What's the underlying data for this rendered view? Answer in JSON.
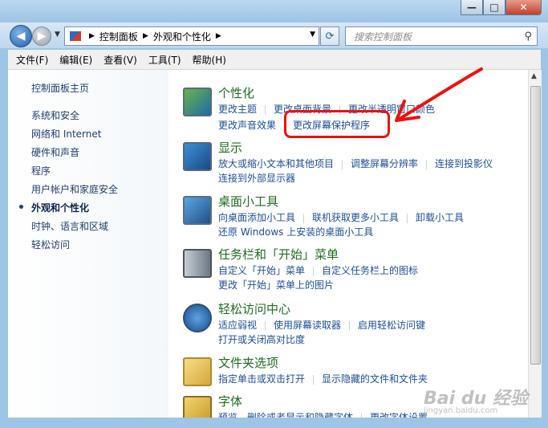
{
  "titlebar": {
    "minimize": "—",
    "maximize": "□",
    "close": "✕"
  },
  "address": {
    "crumbs": [
      "控制面板",
      "外观和个性化"
    ],
    "search_placeholder": "搜索控制面板"
  },
  "menu": [
    "文件(F)",
    "编辑(E)",
    "查看(V)",
    "工具(T)",
    "帮助(H)"
  ],
  "sidebar": {
    "home": "控制面板主页",
    "items": [
      "系统和安全",
      "网络和 Internet",
      "硬件和声音",
      "程序",
      "用户帐户和家庭安全",
      "外观和个性化",
      "时钟、语言和区域",
      "轻松访问"
    ],
    "current_index": 5
  },
  "categories": [
    {
      "title": "个性化",
      "icon": "personalization-icon",
      "rows": [
        [
          "更改主题",
          "更改桌面背景",
          "更改半透明窗口颜色"
        ],
        [
          "更改声音效果",
          "更改屏幕保护程序"
        ]
      ]
    },
    {
      "title": "显示",
      "icon": "display-icon",
      "rows": [
        [
          "放大或缩小文本和其他项目",
          "调整屏幕分辨率",
          "连接到投影仪"
        ],
        [
          "连接到外部显示器"
        ]
      ]
    },
    {
      "title": "桌面小工具",
      "icon": "gadgets-icon",
      "rows": [
        [
          "向桌面添加小工具",
          "联机获取更多小工具",
          "卸载小工具"
        ],
        [
          "还原 Windows 上安装的桌面小工具"
        ]
      ]
    },
    {
      "title": "任务栏和「开始」菜单",
      "icon": "taskbar-icon",
      "rows": [
        [
          "自定义「开始」菜单",
          "自定义任务栏上的图标"
        ],
        [
          "更改「开始」菜单上的图片"
        ]
      ]
    },
    {
      "title": "轻松访问中心",
      "icon": "ease-of-access-icon",
      "rows": [
        [
          "适应弱视",
          "使用屏幕读取器",
          "启用轻松访问键"
        ],
        [
          "打开或关闭高对比度"
        ]
      ]
    },
    {
      "title": "文件夹选项",
      "icon": "folder-options-icon",
      "rows": [
        [
          "指定单击或双击打开",
          "显示隐藏的文件和文件夹"
        ]
      ]
    },
    {
      "title": "字体",
      "icon": "fonts-icon",
      "rows": [
        [
          "预览、删除或者显示和隐藏字体",
          "更改字体设置"
        ]
      ]
    }
  ],
  "annotation": {
    "color": "#ee1111"
  },
  "watermark": {
    "text": "Bai du 经验",
    "sub": "jingyan.baidu.com"
  }
}
